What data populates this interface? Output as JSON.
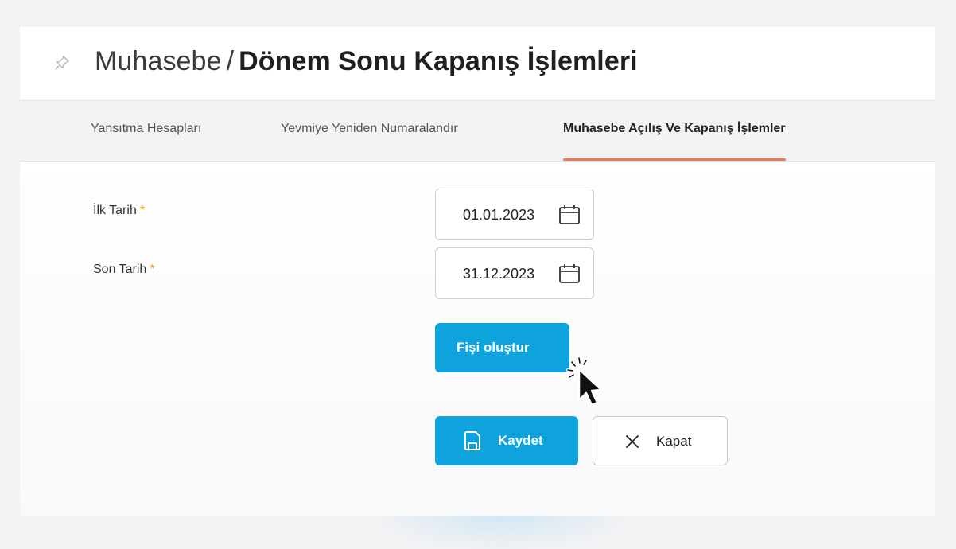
{
  "header": {
    "breadcrumb_parent": "Muhasebe",
    "separator": "/",
    "title": "Dönem Sonu Kapanış İşlemleri",
    "pin_icon": "pin-icon"
  },
  "tabs": [
    {
      "label": "Yansıtma Hesapları",
      "active": false
    },
    {
      "label": "Yevmiye Yeniden Numaralandır",
      "active": false
    },
    {
      "label": "Muhasebe Açılış Ve Kapanış İşlemler",
      "active": true
    }
  ],
  "form": {
    "start_date": {
      "label": "İlk Tarih",
      "required_mark": "*",
      "value": "01.01.2023",
      "icon": "calendar-icon"
    },
    "end_date": {
      "label": "Son Tarih",
      "required_mark": "*",
      "value": "31.12.2023",
      "icon": "calendar-icon"
    }
  },
  "buttons": {
    "create_voucher": "Fişi oluştur",
    "save": "Kaydet",
    "close": "Kapat"
  },
  "colors": {
    "accent": "#0fa3dd",
    "active_tab_underline": "#ee7a4d",
    "required": "#f2a600"
  }
}
